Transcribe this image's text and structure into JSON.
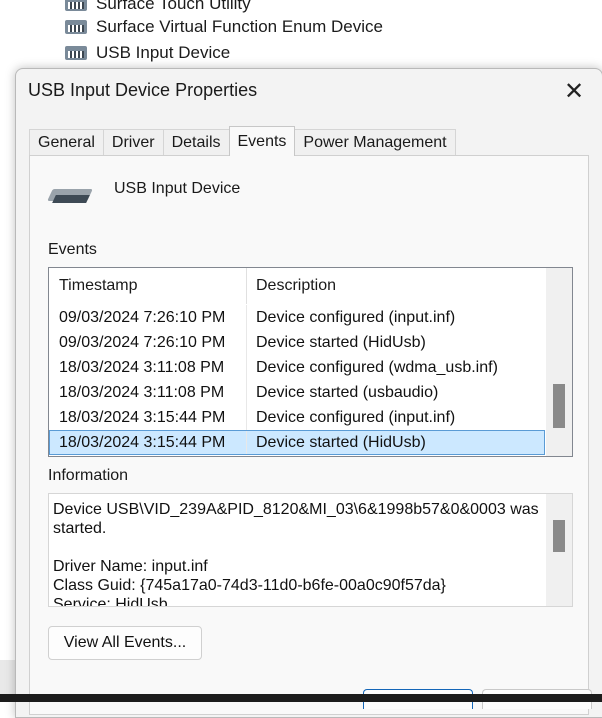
{
  "background_tree": {
    "items": [
      {
        "label": "Surface Touch Utility",
        "icon": "device-icon"
      },
      {
        "label": "Surface Virtual Function Enum Device",
        "icon": "device-icon"
      },
      {
        "label": "USB Input Device",
        "icon": "device-icon"
      }
    ]
  },
  "dialog": {
    "title": "USB Input Device Properties",
    "close_icon": "close-icon",
    "tabs": [
      {
        "label": "General",
        "active": false
      },
      {
        "label": "Driver",
        "active": false
      },
      {
        "label": "Details",
        "active": false
      },
      {
        "label": "Events",
        "active": true
      },
      {
        "label": "Power Management",
        "active": false
      }
    ],
    "device_name": "USB Input Device",
    "device_icon": "usb-device-icon",
    "events_label": "Events",
    "events_table": {
      "columns": [
        "Timestamp",
        "Description"
      ],
      "rows": [
        {
          "timestamp": "09/03/2024 7:26:10 PM",
          "description": "Device configured (input.inf)"
        },
        {
          "timestamp": "09/03/2024 7:26:10 PM",
          "description": "Device started (HidUsb)"
        },
        {
          "timestamp": "18/03/2024 3:11:08 PM",
          "description": "Device configured (wdma_usb.inf)"
        },
        {
          "timestamp": "18/03/2024 3:11:08 PM",
          "description": "Device started (usbaudio)"
        },
        {
          "timestamp": "18/03/2024 3:15:44 PM",
          "description": "Device configured (input.inf)"
        },
        {
          "timestamp": "18/03/2024 3:15:44 PM",
          "description": "Device started (HidUsb)"
        }
      ],
      "selected_index": 5
    },
    "information_label": "Information",
    "information_text": "Device USB\\VID_239A&PID_8120&MI_03\\6&1998b57&0&0003 was started.\n\nDriver Name: input.inf\nClass Guid: {745a17a0-74d3-11d0-b6fe-00a0c90f57da}\nService: HidUsb",
    "view_all_button": "View All Events..."
  },
  "colors": {
    "selection": "#cce8ff",
    "selection_border": "#5a9bd5",
    "dialog_bg": "#f3f3f3"
  }
}
